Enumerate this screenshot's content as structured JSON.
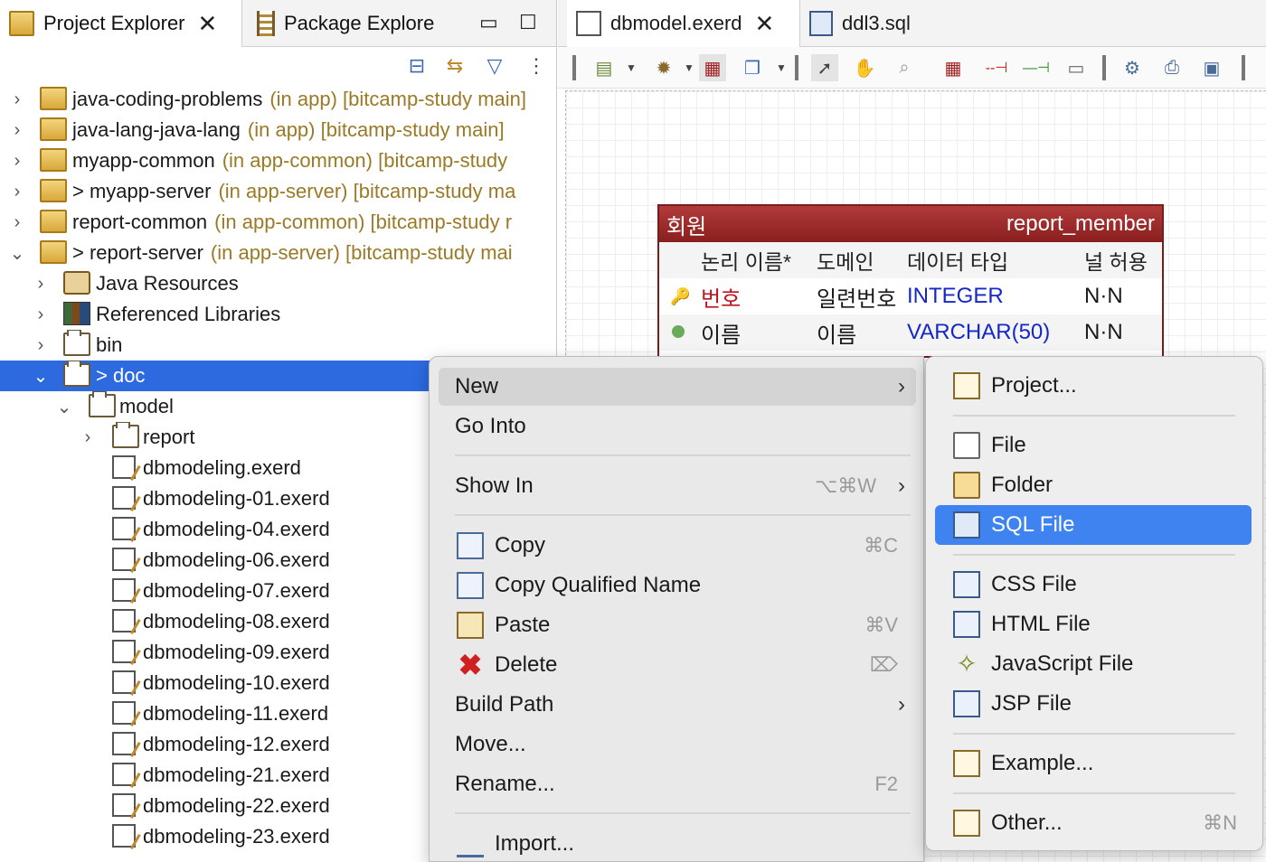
{
  "left_pane": {
    "tabs": [
      {
        "label": "Project Explorer",
        "active": true
      },
      {
        "label": "Package Explore",
        "active": false
      }
    ],
    "minimize": "▭",
    "maximize": "☐",
    "toolbar": [
      "collapse-all-icon",
      "link-with-editor-icon",
      "filter-icon",
      "view-menu-icon"
    ],
    "tree": [
      {
        "name": "java-coding-problems",
        "decor": "(in app) [bitcamp-study main]",
        "prefix": ""
      },
      {
        "name": "java-lang-java-lang",
        "decor": "(in app) [bitcamp-study main]",
        "prefix": ""
      },
      {
        "name": "myapp-common",
        "decor": "(in app-common) [bitcamp-study",
        "prefix": ""
      },
      {
        "name": "myapp-server",
        "decor": "(in app-server) [bitcamp-study ma",
        "prefix": "> "
      },
      {
        "name": "report-common",
        "decor": "(in app-common) [bitcamp-study r",
        "prefix": ""
      },
      {
        "name": "report-server",
        "decor": "(in app-server) [bitcamp-study mai",
        "prefix": "> "
      },
      {
        "name": "Java Resources"
      },
      {
        "name": "Referenced Libraries"
      },
      {
        "name": "bin"
      },
      {
        "name": "> doc"
      },
      {
        "name": "model"
      },
      {
        "name": "report"
      },
      {
        "name": "dbmodeling.exerd"
      },
      {
        "name": "dbmodeling-01.exerd"
      },
      {
        "name": "dbmodeling-04.exerd"
      },
      {
        "name": "dbmodeling-06.exerd"
      },
      {
        "name": "dbmodeling-07.exerd"
      },
      {
        "name": "dbmodeling-08.exerd"
      },
      {
        "name": "dbmodeling-09.exerd"
      },
      {
        "name": "dbmodeling-10.exerd"
      },
      {
        "name": "dbmodeling-11.exerd"
      },
      {
        "name": "dbmodeling-12.exerd"
      },
      {
        "name": "dbmodeling-21.exerd"
      },
      {
        "name": "dbmodeling-22.exerd"
      },
      {
        "name": "dbmodeling-23.exerd"
      }
    ]
  },
  "editor": {
    "tabs": [
      {
        "label": "dbmodel.exerd",
        "active": true
      },
      {
        "label": "ddl3.sql",
        "active": false
      }
    ],
    "entity": {
      "logical_name": "회원",
      "physical_name": "report_member",
      "columns": [
        "논리 이름*",
        "도메인",
        "데이터 타입",
        "널 허용"
      ],
      "rows": [
        {
          "name": "번호",
          "domain": "일련번호",
          "type": "INTEGER",
          "nullable": "N·N",
          "pk": true
        },
        {
          "name": "이름",
          "domain": "이름",
          "type": "VARCHAR(50)",
          "nullable": "N·N",
          "pk": false
        }
      ]
    }
  },
  "context_menu": {
    "items": {
      "new": "New",
      "go_into": "Go Into",
      "show_in": "Show In",
      "show_in_sc": "⌥⌘W",
      "copy": "Copy",
      "copy_sc": "⌘C",
      "copy_qn": "Copy Qualified Name",
      "paste": "Paste",
      "paste_sc": "⌘V",
      "delete": "Delete",
      "delete_sc": "⌦",
      "build_path": "Build Path",
      "move": "Move...",
      "rename": "Rename...",
      "rename_sc": "F2",
      "import": "Import..."
    }
  },
  "sub_menu": {
    "items": {
      "project": "Project...",
      "file": "File",
      "folder": "Folder",
      "sql_file": "SQL File",
      "css_file": "CSS File",
      "html_file": "HTML File",
      "js_file": "JavaScript File",
      "jsp_file": "JSP File",
      "example": "Example...",
      "other": "Other...",
      "other_sc": "⌘N"
    }
  },
  "colors": {
    "selection": "#2d6ae0",
    "submenu_highlight": "#3e83f0",
    "entity_header": "#8a1f1f",
    "pk_text": "#c0141c",
    "type_text": "#1428c8",
    "decoration": "#9a7a26"
  }
}
